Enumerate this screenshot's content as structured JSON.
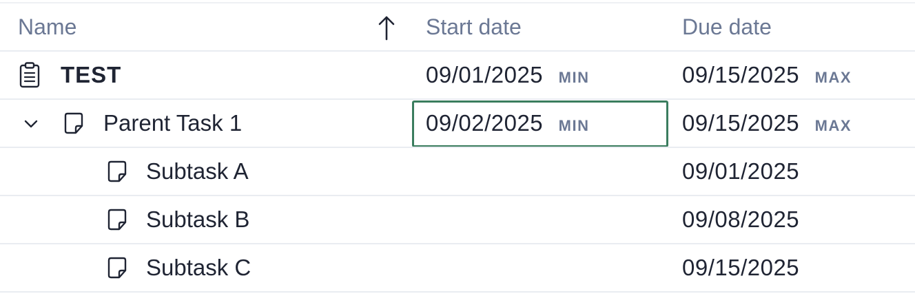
{
  "header": {
    "name_label": "Name",
    "start_label": "Start date",
    "due_label": "Due date",
    "sort_icon": "arrow-up-icon"
  },
  "rows": [
    {
      "name": "TEST",
      "icon": "clipboard-icon",
      "start_date": "09/01/2025",
      "start_tag": "MIN",
      "due_date": "09/15/2025",
      "due_tag": "MAX"
    },
    {
      "name": "Parent Task 1",
      "icon": "note-icon",
      "expander_icon": "chevron-down-icon",
      "start_date": "09/02/2025",
      "start_tag": "MIN",
      "due_date": "09/15/2025",
      "due_tag": "MAX",
      "selected_cell": "start_date"
    },
    {
      "name": "Subtask A",
      "icon": "note-icon",
      "start_date": "",
      "due_date": "09/01/2025"
    },
    {
      "name": "Subtask B",
      "icon": "note-icon",
      "start_date": "",
      "due_date": "09/08/2025"
    },
    {
      "name": "Subtask C",
      "icon": "note-icon",
      "start_date": "",
      "due_date": "09/15/2025"
    }
  ],
  "colors": {
    "header_text": "#6b7894",
    "body_text": "#1f2433",
    "selection_border": "#3a7d5e",
    "row_divider": "#e9ecf1"
  }
}
